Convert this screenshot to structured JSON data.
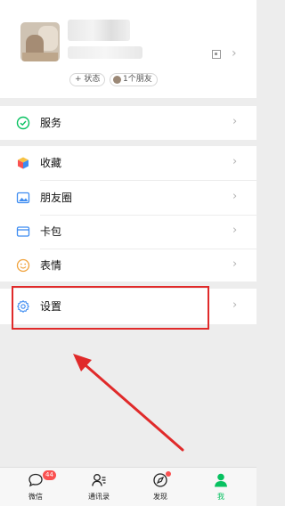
{
  "profile": {
    "status_chip": "+ 状态",
    "friends_chip": "1个朋友"
  },
  "menu": {
    "services": "服务",
    "favorites": "收藏",
    "moments": "朋友圈",
    "cards": "卡包",
    "stickers": "表情",
    "settings": "设置"
  },
  "tabbar": {
    "chats": "微信",
    "chats_badge": "44",
    "contacts": "通讯录",
    "discover": "发现",
    "me": "我"
  },
  "colors": {
    "wechat_green": "#07c160",
    "annotation_red": "#e02a2a",
    "badge_red": "#fa5151"
  }
}
